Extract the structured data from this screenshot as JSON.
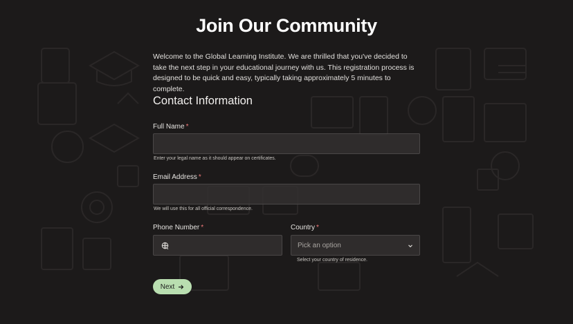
{
  "page": {
    "title": "Join Our Community",
    "intro": "Welcome to the Global Learning Institute. We are thrilled that you've decided to take the next step in your educational journey with us. This registration process is designed to be quick and easy, typically taking approximately 5 minutes to complete.",
    "section_title": "Contact Information"
  },
  "form": {
    "full_name": {
      "label": "Full Name",
      "required": "*",
      "value": "",
      "hint": "Enter your legal name as it should appear on certificates."
    },
    "email": {
      "label": "Email Address",
      "required": "*",
      "value": "",
      "hint": "We will use this for all official correspondence."
    },
    "phone": {
      "label": "Phone Number",
      "required": "*",
      "value": "",
      "icon": "globe-phone-icon"
    },
    "country": {
      "label": "Country",
      "required": "*",
      "placeholder": "Pick an option",
      "hint": "Select your country of residence.",
      "icon": "chevron-down-icon"
    }
  },
  "actions": {
    "next_label": "Next",
    "next_icon": "arrow-right-icon"
  },
  "colors": {
    "background": "#1c1a1a",
    "accent": "#b9deb0",
    "required": "#f07a7a"
  }
}
